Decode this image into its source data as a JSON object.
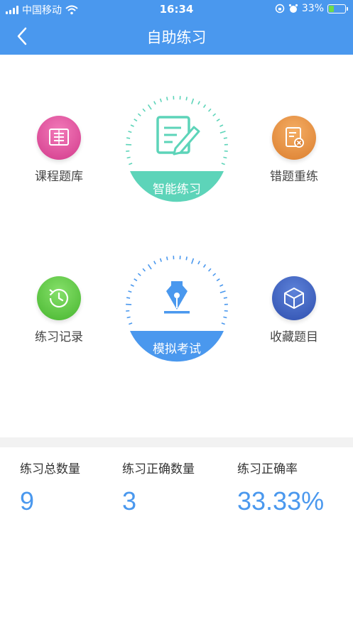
{
  "status_bar": {
    "carrier": "中国移动",
    "time": "16:34",
    "battery": "33%"
  },
  "nav": {
    "title": "自助练习"
  },
  "menu": {
    "course_bank": "课程题库",
    "smart_practice": "智能练习",
    "wrong_redo": "错题重练",
    "practice_record": "练习记录",
    "mock_exam": "模拟考试",
    "favorites": "收藏题目"
  },
  "stats": {
    "total_label": "练习总数量",
    "total_value": "9",
    "correct_label": "练习正确数量",
    "correct_value": "3",
    "rate_label": "练习正确率",
    "rate_value": "33.33%"
  },
  "colors": {
    "primary": "#4a98ee",
    "teal": "#5dd4b9",
    "pink": "#e0479a",
    "orange": "#e08a38",
    "green": "#55c83a",
    "navy": "#3a5fc4"
  }
}
